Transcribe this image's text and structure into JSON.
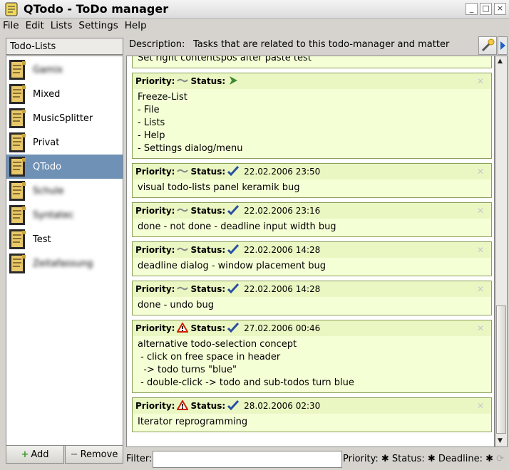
{
  "window": {
    "title": "QTodo - ToDo manager"
  },
  "menu": [
    {
      "label": "File"
    },
    {
      "label": "Edit"
    },
    {
      "label": "Lists"
    },
    {
      "label": "Settings"
    },
    {
      "label": "Help"
    }
  ],
  "todo_lists": {
    "header": "Todo-Lists",
    "items": [
      {
        "label": "Gamix",
        "blurred": true
      },
      {
        "label": "Mixed",
        "blurred": false
      },
      {
        "label": "MusicSplitter",
        "blurred": false
      },
      {
        "label": "Privat",
        "blurred": false
      },
      {
        "label": "QTodo",
        "blurred": false,
        "selected": true
      },
      {
        "label": "Schule",
        "blurred": true
      },
      {
        "label": "Syntatec",
        "blurred": true
      },
      {
        "label": "Test",
        "blurred": false
      },
      {
        "label": "Zeitafassung",
        "blurred": true
      }
    ],
    "add_label": "Add",
    "remove_label": "Remove"
  },
  "description": {
    "label": "Description:",
    "value": "Tasks that are related to this todo-manager and matter"
  },
  "todos": [
    {
      "partial": true,
      "lines": [
        "Set right contentspos after paste test"
      ]
    },
    {
      "priority": "normal",
      "status": "in-progress",
      "date": "",
      "lines": [
        "Freeze-List",
        "- File",
        "- Lists",
        "- Help",
        "- Settings dialog/menu"
      ]
    },
    {
      "priority": "normal",
      "status": "done",
      "date": "22.02.2006 23:50",
      "lines": [
        "visual todo-lists panel keramik bug"
      ]
    },
    {
      "priority": "normal",
      "status": "done",
      "date": "22.02.2006 23:16",
      "lines": [
        "done - not done - deadline input width bug"
      ]
    },
    {
      "priority": "normal",
      "status": "done",
      "date": "22.02.2006 14:28",
      "lines": [
        "deadline dialog - window placement bug"
      ]
    },
    {
      "priority": "normal",
      "status": "done",
      "date": "22.02.2006 14:28",
      "lines": [
        "done - undo bug"
      ]
    },
    {
      "priority": "high",
      "status": "done",
      "date": "27.02.2006 00:46",
      "lines": [
        "alternative todo-selection concept",
        " - click on free space in header",
        "  -> todo turns \"blue\"",
        " - double-click -> todo and sub-todos turn blue"
      ]
    },
    {
      "priority": "high",
      "status": "done",
      "date": "28.02.2006 02:30",
      "lines": [
        "Iterator reprogramming"
      ]
    }
  ],
  "todo_labels": {
    "priority": "Priority:",
    "status": "Status:"
  },
  "statusbar": {
    "filter_label": "Filter:",
    "filter_value": "",
    "priority_label": "Priority:",
    "status_label": "Status:",
    "deadline_label": "Deadline:"
  },
  "colors": {
    "selection": "#6f91b5",
    "todo_bg": "#f5ffd6",
    "todo_header_bg": "#ebf7c3",
    "done_check": "#2a4fa0",
    "priority_high": "#cc2200",
    "in_progress": "#3c8a2e"
  }
}
